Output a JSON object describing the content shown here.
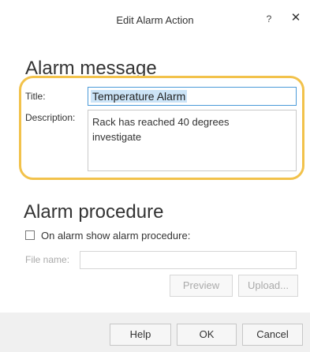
{
  "window": {
    "title": "Edit Alarm Action",
    "help_glyph": "?",
    "close_glyph": "✕"
  },
  "alarm_message": {
    "heading": "Alarm message",
    "title_label": "Title:",
    "title_value": "Temperature Alarm",
    "description_label": "Description:",
    "description_value": "Rack has reached 40 degrees\ninvestigate",
    "highlight_color": "#f2c24b"
  },
  "alarm_procedure": {
    "heading": "Alarm procedure",
    "checkbox_label": "On alarm show alarm procedure:",
    "checkbox_checked": false,
    "file_name_label": "File name:",
    "file_name_value": "",
    "preview_label": "Preview",
    "upload_label": "Upload..."
  },
  "footer": {
    "help_label": "Help",
    "ok_label": "OK",
    "cancel_label": "Cancel"
  }
}
